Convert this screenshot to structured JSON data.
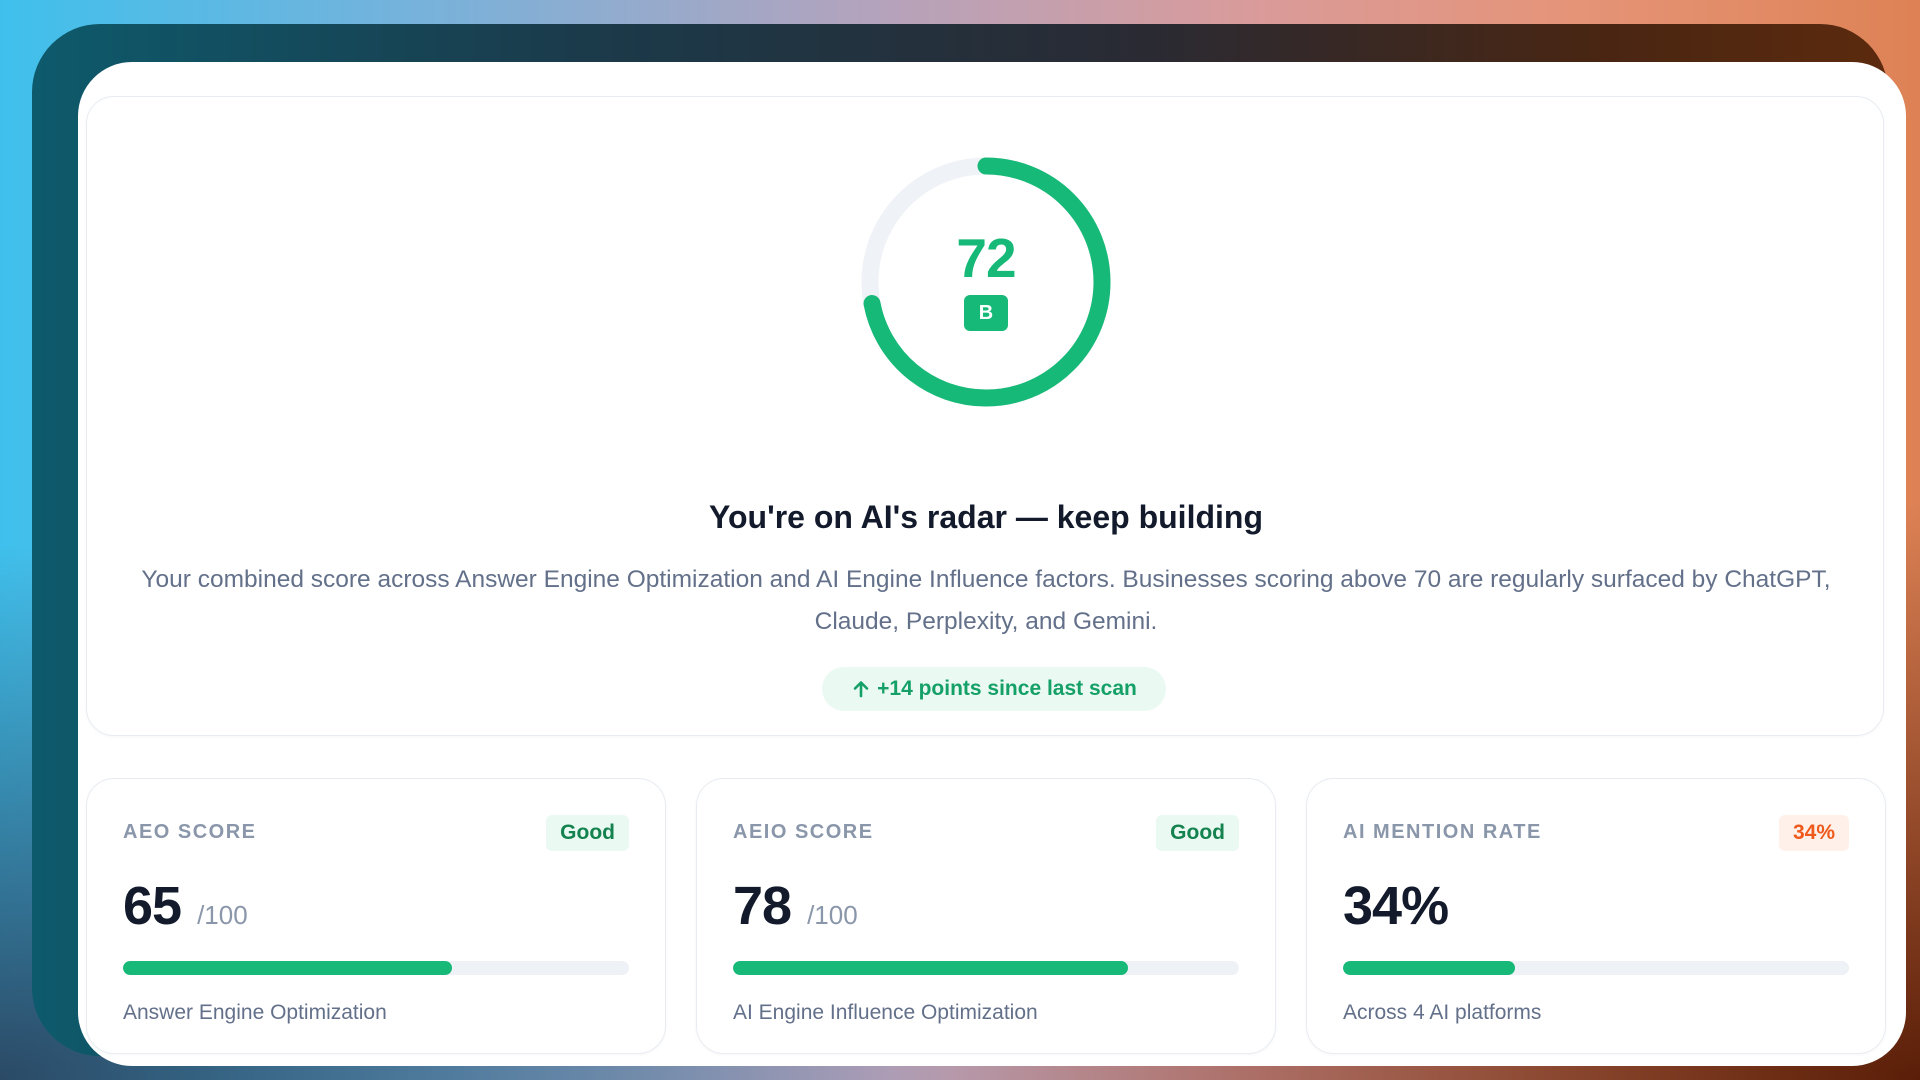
{
  "overall": {
    "score": "72",
    "score_value": 72,
    "grade": "B",
    "headline": "You're on AI's radar — keep building",
    "description": "Your combined score across Answer Engine Optimization and AI Engine Influence factors. Businesses scoring above 70 are regularly surfaced by ChatGPT, Claude, Perplexity, and Gemini.",
    "delta_label": "+14 points since last scan"
  },
  "cards": [
    {
      "label": "AEO SCORE",
      "badge": "Good",
      "score": "65",
      "max": "/100",
      "progress": 0.65,
      "caption": "Answer Engine Optimization"
    },
    {
      "label": "AEIO SCORE",
      "badge": "Good",
      "score": "78",
      "max": "/100",
      "progress": 0.78,
      "caption": "AI Engine Influence Optimization"
    },
    {
      "label": "AI MENTION RATE",
      "badge": "34%",
      "score": "34%",
      "progress": 0.34,
      "caption": "Across 4 AI platforms"
    }
  ],
  "colors": {
    "accent": "#17b978",
    "warning": "#ef5a1c",
    "track": "#eef2f6"
  },
  "icons": {
    "delta": "arrow-up-icon"
  }
}
